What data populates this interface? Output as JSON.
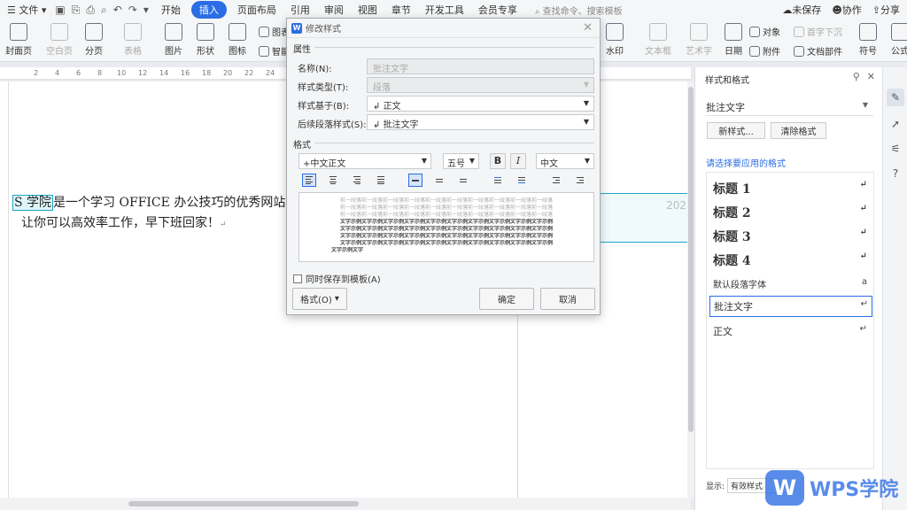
{
  "menubar": {
    "file": "文件",
    "tabs": [
      "开始",
      "插入",
      "页面布局",
      "引用",
      "审阅",
      "视图",
      "章节",
      "开发工具",
      "会员专享"
    ],
    "active_tab": "插入",
    "search": "查找命令、搜索模板",
    "unsaved": "未保存",
    "collab": "协作",
    "share": "分享"
  },
  "ribbon": {
    "cover": "封面页",
    "blank": "空白页",
    "pagebreak": "分页",
    "table": "表格",
    "picture": "图片",
    "shape": "形状",
    "icon": "图标",
    "chart": "图表",
    "smart": "智能",
    "watermark": "水印",
    "textbox": "文本框",
    "arttext": "艺术字",
    "date": "日期",
    "object": "对象",
    "dropcap": "首字下沉",
    "attachment": "附件",
    "docparts": "文档部件",
    "symbol": "符号",
    "formula": "公式"
  },
  "ruler": [
    "2",
    "4",
    "6",
    "8",
    "10",
    "12",
    "14",
    "16",
    "18",
    "20",
    "22",
    "24"
  ],
  "document": {
    "highlight": "S 学院",
    "line1_rest": "是一个学习 OFFICE 办公技巧的优秀网站，在",
    "line2": "让你可以高效率工作，早下班回家！",
    "comment_year": "202"
  },
  "dialog": {
    "title": "修改样式",
    "section_props": "属性",
    "name_label": "名称(N):",
    "name_value": "批注文字",
    "type_label": "样式类型(T):",
    "type_value": "段落",
    "based_label": "样式基于(B):",
    "based_value": "正文",
    "next_label": "后续段落样式(S):",
    "next_value": "批注文字",
    "section_format": "格式",
    "font": "+中文正文",
    "size": "五号",
    "bold": "B",
    "italic": "I",
    "script": "中文",
    "preview_prev": "前一段落前一段落前一段落前一段落前一段落前一段落前一段落前一段落前一段落前一段落",
    "preview_sample": "文字示例文字示例文字示例文字示例文字示例文字示例文字示例文字示例文字示例文字示例",
    "preview_tail": "文字示例文字",
    "save_template": "同时保存到模板(A)",
    "format_btn": "格式(O)",
    "ok": "确定",
    "cancel": "取消"
  },
  "panel": {
    "title": "样式和格式",
    "current": "批注文字",
    "new_style": "新样式...",
    "clear_format": "清除格式",
    "select_label": "请选择要应用的格式",
    "styles": [
      {
        "name": "标题 1",
        "mark": "↵"
      },
      {
        "name": "标题 2",
        "mark": "↵"
      },
      {
        "name": "标题 3",
        "mark": "↵"
      },
      {
        "name": "标题 4",
        "mark": "↵"
      },
      {
        "name": "默认段落字体",
        "mark": "a"
      },
      {
        "name": "批注文字",
        "mark": "↵"
      },
      {
        "name": "正文",
        "mark": "↵"
      }
    ],
    "show_label": "显示:",
    "show_value": "有效样式"
  },
  "watermark": {
    "text": "WPS学院",
    "logo": "W"
  },
  "colors": {
    "accent": "#2b6de5",
    "highlight": "#1ea7c5"
  }
}
